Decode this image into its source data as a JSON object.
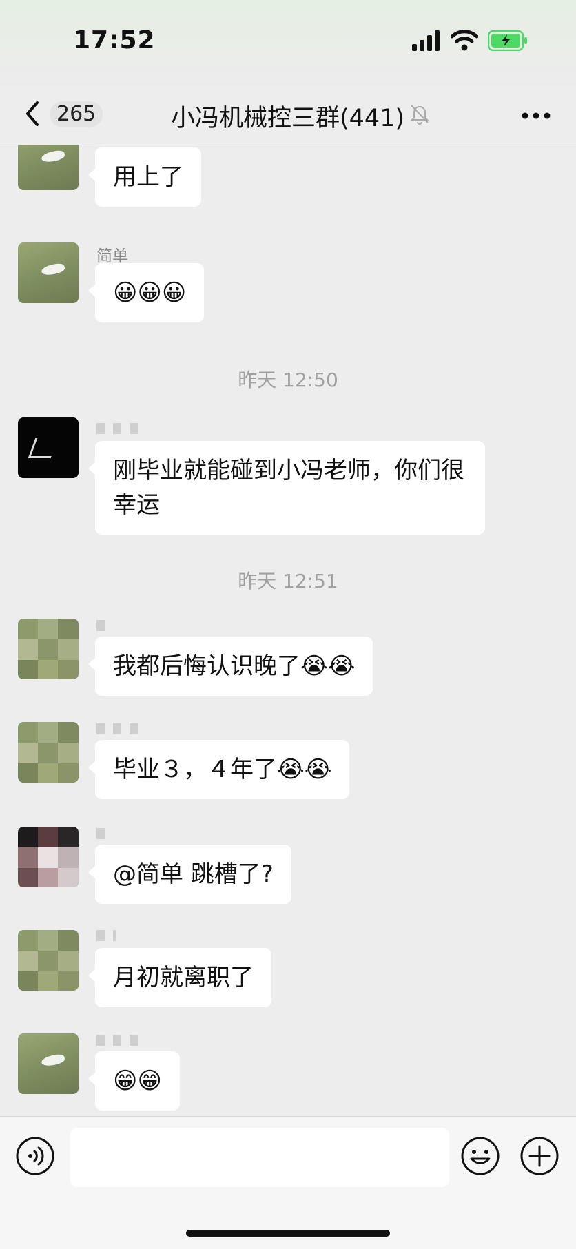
{
  "status_bar": {
    "time": "17:52"
  },
  "nav": {
    "unread_count": "265",
    "title": "小冯机械控三群(441)"
  },
  "messages": [
    {
      "sender": "",
      "text": "用上了"
    },
    {
      "sender": "简单",
      "text": "😀😀😀"
    },
    {
      "divider": "昨天 12:50"
    },
    {
      "sender": "",
      "text": "刚毕业就能碰到小冯老师，你们很幸运"
    },
    {
      "divider": "昨天 12:51"
    },
    {
      "sender": "",
      "text": "我都后悔认识晚了😭😭"
    },
    {
      "sender": "",
      "text": "毕业３，４年了😭😭"
    },
    {
      "sender": "",
      "text": "@简单 跳槽了?"
    },
    {
      "sender": "",
      "text": "月初就离职了"
    },
    {
      "sender": "",
      "text": "😁😁"
    }
  ],
  "input": {
    "placeholder": ""
  },
  "icons": {
    "back": "chevron-left-icon",
    "mute": "bell-off-icon",
    "more": "more-dots-icon",
    "voice": "voice-icon",
    "emoji": "emoji-icon",
    "plus": "plus-icon"
  },
  "colors": {
    "battery": "#4cd964",
    "bubble": "#ffffff",
    "background": "#ededed"
  }
}
